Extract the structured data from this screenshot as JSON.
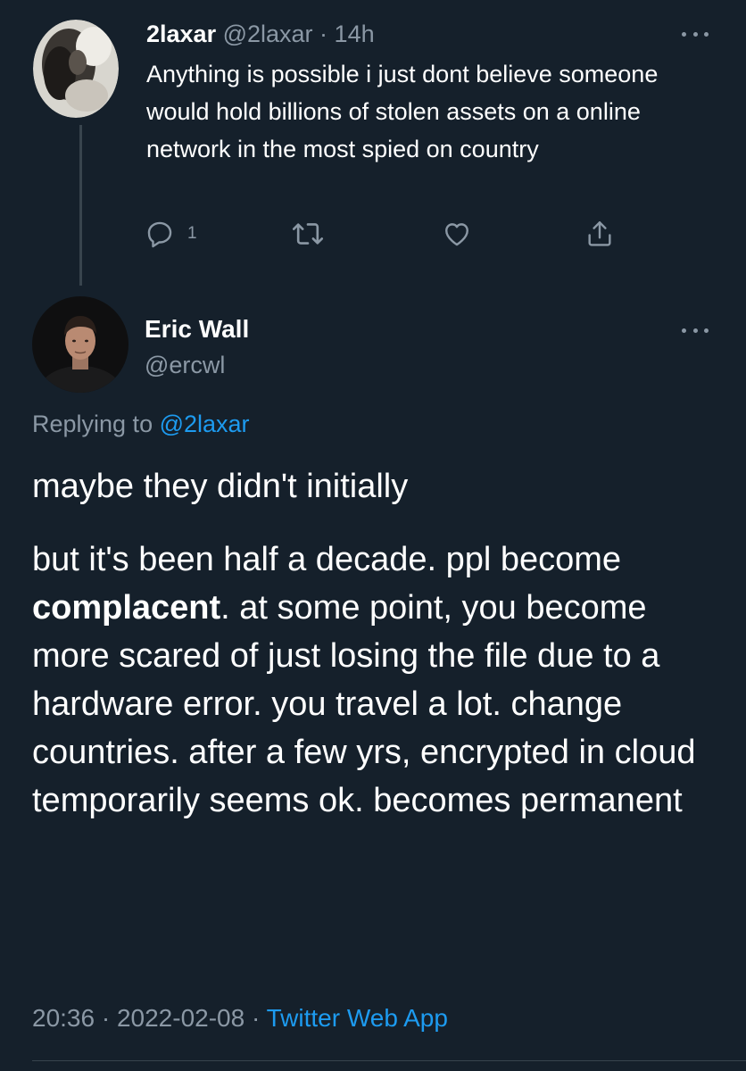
{
  "parent_tweet": {
    "display_name": "2laxar",
    "handle": "@2laxar",
    "separator": " · ",
    "time": "14h",
    "text": "Anything is possible i just dont believe someone would hold billions of stolen assets on a online network in the most spied on country",
    "reply_count": "1",
    "icons": [
      "reply-icon",
      "retweet-icon",
      "like-icon",
      "share-icon",
      "more-icon"
    ]
  },
  "main_tweet": {
    "display_name": "Eric Wall",
    "handle": "@ercwl",
    "replying_label": "Replying to ",
    "replying_handle": "@2laxar",
    "paragraph1": "maybe they didn't initially",
    "paragraph2_before": "but it's been half a decade. ppl become ",
    "paragraph2_bold": "complacent",
    "paragraph2_after": ". at some point, you become more scared of just losing the file due to a hardware error. you travel a lot. change countries. after a few yrs, encrypted in cloud temporarily seems ok. becomes permanent",
    "time": "20:36",
    "date": "2022-02-08",
    "separator": " · ",
    "source": "Twitter Web App"
  },
  "colors": {
    "background": "#15202b",
    "text": "#ffffff",
    "secondary": "#8b98a5",
    "accent": "#1d9bf0",
    "divider": "#38444d"
  }
}
